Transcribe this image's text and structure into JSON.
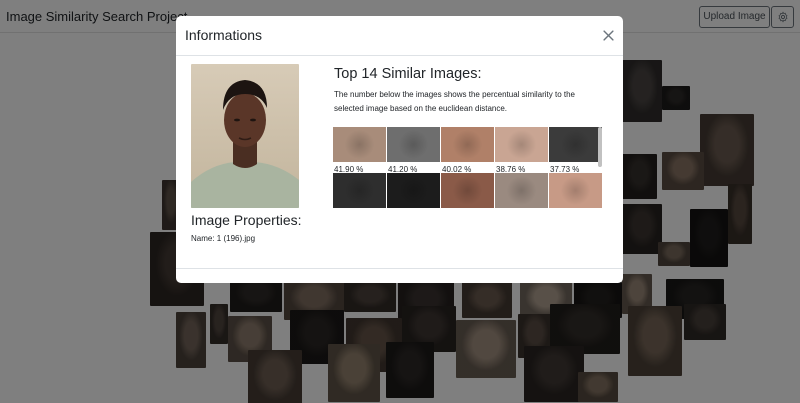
{
  "header": {
    "title": "Image Similarity Search Project",
    "upload_label": "Upload Image",
    "settings_icon": "gear-icon"
  },
  "background_faces": [
    "#4a4543",
    "#2d2a28",
    "#6b5b50",
    "#35302c",
    "#8a7565",
    "#1f1d1c",
    "#57493f",
    "#3c3531",
    "#7a6a5c",
    "#262422",
    "#9a8878",
    "#443a34",
    "#5f5249",
    "#2f2b28",
    "#816f61",
    "#4d433c",
    "#3a3330",
    "#6a5a4e",
    "#b0a090",
    "#23201e",
    "#74655a",
    "#51463f",
    "#8f7d6e",
    "#2a2624",
    "#665549",
    "#3f3733",
    "#a29080",
    "#5a4d44",
    "#332e2a",
    "#786758",
    "#48403a",
    "#95836f",
    "#2c2826",
    "#6e5e52",
    "#403834",
    "#857362"
  ],
  "modal": {
    "title": "Informations",
    "close_icon": "close-icon",
    "selected_image_alt": "selected face portrait",
    "properties_title": "Image Properties:",
    "name_label": "Name:",
    "name_value": "1 (196).jpg",
    "similar_title": "Top 14 Similar Images:",
    "similar_desc": "The number below the images shows the percentual similarity to the selected image based on the euclidean distance.",
    "results": [
      {
        "similarity": "41.90 %",
        "tone": "#a88c7a"
      },
      {
        "similarity": "41.20 %",
        "tone": "#6e6e6e"
      },
      {
        "similarity": "40.02 %",
        "tone": "#b08068"
      },
      {
        "similarity": "38.76 %",
        "tone": "#c9a593"
      },
      {
        "similarity": "37.73 %",
        "tone": "#3b3b3b"
      },
      {
        "similarity": "",
        "tone": "#2e2e2e"
      },
      {
        "similarity": "",
        "tone": "#1c1c1c"
      },
      {
        "similarity": "",
        "tone": "#8a5a48"
      },
      {
        "similarity": "",
        "tone": "#9a8a80"
      },
      {
        "similarity": "",
        "tone": "#c79a86"
      }
    ]
  }
}
